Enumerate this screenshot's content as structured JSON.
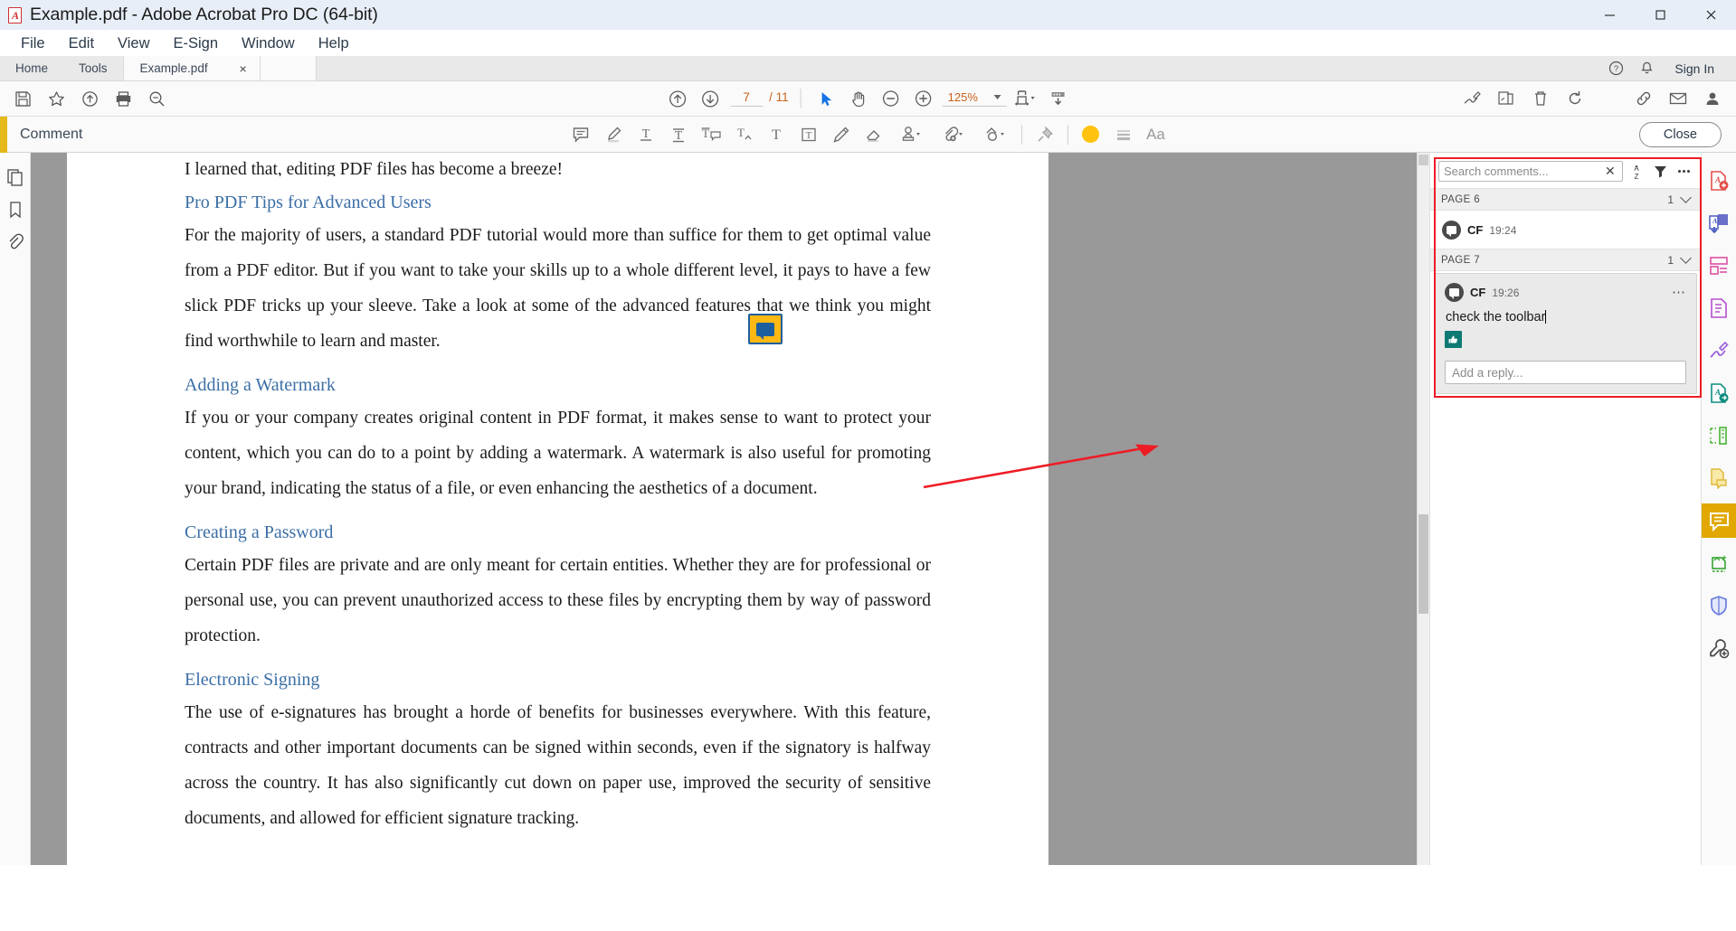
{
  "window": {
    "title": "Example.pdf - Adobe Acrobat Pro DC (64-bit)",
    "app_icon": "acrobat-logo-icon",
    "minimize": "—",
    "maximize": "❐",
    "close": "✕"
  },
  "menubar": {
    "items": [
      "File",
      "Edit",
      "View",
      "E-Sign",
      "Window",
      "Help"
    ]
  },
  "tabbar": {
    "home": "Home",
    "tools": "Tools",
    "document_tab": "Example.pdf",
    "tab_close": "×",
    "help_icon": "help-circle-icon",
    "bell_icon": "notification-bell-icon",
    "signin": "Sign In"
  },
  "toolbar": {
    "save_icon": "save-icon",
    "star_icon": "add-to-favorites-star-icon",
    "upload_icon": "upload-cloud-icon",
    "print_icon": "print-icon",
    "zoom_tool_icon": "magnifier-icon",
    "prev_page_icon": "previous-page-arrow-icon",
    "next_page_icon": "next-page-arrow-icon",
    "page_number": "7",
    "page_total": "/ 11",
    "select_tool_icon": "select-cursor-icon",
    "hand_tool_icon": "hand-pan-icon",
    "zoom_out_icon": "zoom-out-icon",
    "zoom_in_icon": "zoom-in-icon",
    "zoom_level": "125%",
    "fit_page_icon": "fit-width-icon",
    "scroll_mode_icon": "page-display-icon",
    "sign_icon": "fill-and-sign-icon",
    "stamp_icon": "request-signature-icon",
    "delete_icon": "delete-pages-icon",
    "rotate_icon": "rotate-page-icon",
    "link_icon": "share-link-icon",
    "mail_icon": "email-icon",
    "account_icon": "user-account-icon"
  },
  "commentbar": {
    "label": "Comment",
    "tools": [
      "sticky-note-icon",
      "highlight-text-icon",
      "underline-text-icon",
      "strikethrough-text-icon",
      "replace-text-icon",
      "insert-text-icon",
      "add-text-comment-icon",
      "text-box-icon",
      "draw-free-form-icon",
      "erase-drawing-icon",
      "add-stamp-icon",
      "attach-file-icon",
      "drawing-shapes-icon"
    ],
    "pin_icon": "pin-icon",
    "color_icon": "color-swatch-icon",
    "color_value": "#FFC20E",
    "thickness_icon": "line-thickness-icon",
    "text_props_icon": "text-properties-icon",
    "text_props_label": "Aa",
    "close_label": "Close"
  },
  "left_rail": {
    "items": [
      "page-thumbnails-icon",
      "bookmarks-icon",
      "attachments-icon"
    ]
  },
  "document": {
    "clipped_line": "I learned that, editing PDF files has become a breeze!",
    "blocks": [
      {
        "type": "heading",
        "text": "Pro PDF Tips for Advanced Users"
      },
      {
        "type": "paragraph",
        "text": "For the majority of users, a standard PDF tutorial would more than suffice for them to get optimal value from a PDF editor. But if you want to take your skills up to a whole different level, it pays to have a few slick PDF tricks up your sleeve. Take a look at some of the advanced features that we think you might find worthwhile to learn and master."
      },
      {
        "type": "heading",
        "text": "Adding a Watermark"
      },
      {
        "type": "paragraph",
        "text": "If you or your company creates original content in PDF format, it makes sense to want to protect your content, which you can do to a point by adding a watermark. A watermark is also useful for promoting your brand, indicating the status of a file, or even enhancing the aesthetics of a document."
      },
      {
        "type": "heading",
        "text": "Creating a Password"
      },
      {
        "type": "paragraph",
        "text": "Certain PDF files are private and are only meant for certain entities. Whether they are for professional or personal use, you can prevent unauthorized access to these files by encrypting them by way of password protection."
      },
      {
        "type": "heading",
        "text": "Electronic Signing"
      },
      {
        "type": "paragraph",
        "text": "The use of e-signatures has brought a horde of benefits for businesses everywhere. With this feature, contracts and other important documents can be signed within seconds, even if the signatory is halfway across the country. It has also significantly cut down on paper use, improved the security of sensitive documents, and allowed for efficient signature tracking."
      }
    ],
    "sticky_note_icon": "sticky-note-annotation-icon"
  },
  "comments_panel": {
    "search": {
      "placeholder": "Search comments...",
      "value": "",
      "clear_icon": "clear-search-icon"
    },
    "sort_icon": "sort-a-z-icon",
    "filter_icon": "filter-icon",
    "options_icon": "more-options-icon",
    "groups": [
      {
        "page_label": "PAGE 6",
        "count": "1",
        "chevron": "chevron-down-icon",
        "comments": [
          {
            "author": "CF",
            "time": "19:24",
            "body": "",
            "selected": false
          }
        ]
      },
      {
        "page_label": "PAGE 7",
        "count": "1",
        "chevron": "chevron-down-icon",
        "comments": [
          {
            "author": "CF",
            "time": "19:26",
            "body": "check the toolbar",
            "selected": true,
            "more_icon": "comment-options-icon",
            "reaction": "👍",
            "reply_placeholder": "Add a reply..."
          }
        ]
      }
    ]
  },
  "right_rail": {
    "items": [
      "create-pdf-icon",
      "combine-files-icon",
      "organize-pages-icon",
      "edit-pdf-icon",
      "fill-and-sign-icon",
      "export-pdf-icon",
      "measure-icon",
      "stamp-tool-icon",
      "comment-tool-icon",
      "enhance-scans-icon",
      "protect-icon",
      "more-tools-icon"
    ],
    "active_index": 8
  },
  "annotation": {
    "arrow_color": "#ee1c25",
    "highlight_color": "#ee1c25"
  }
}
